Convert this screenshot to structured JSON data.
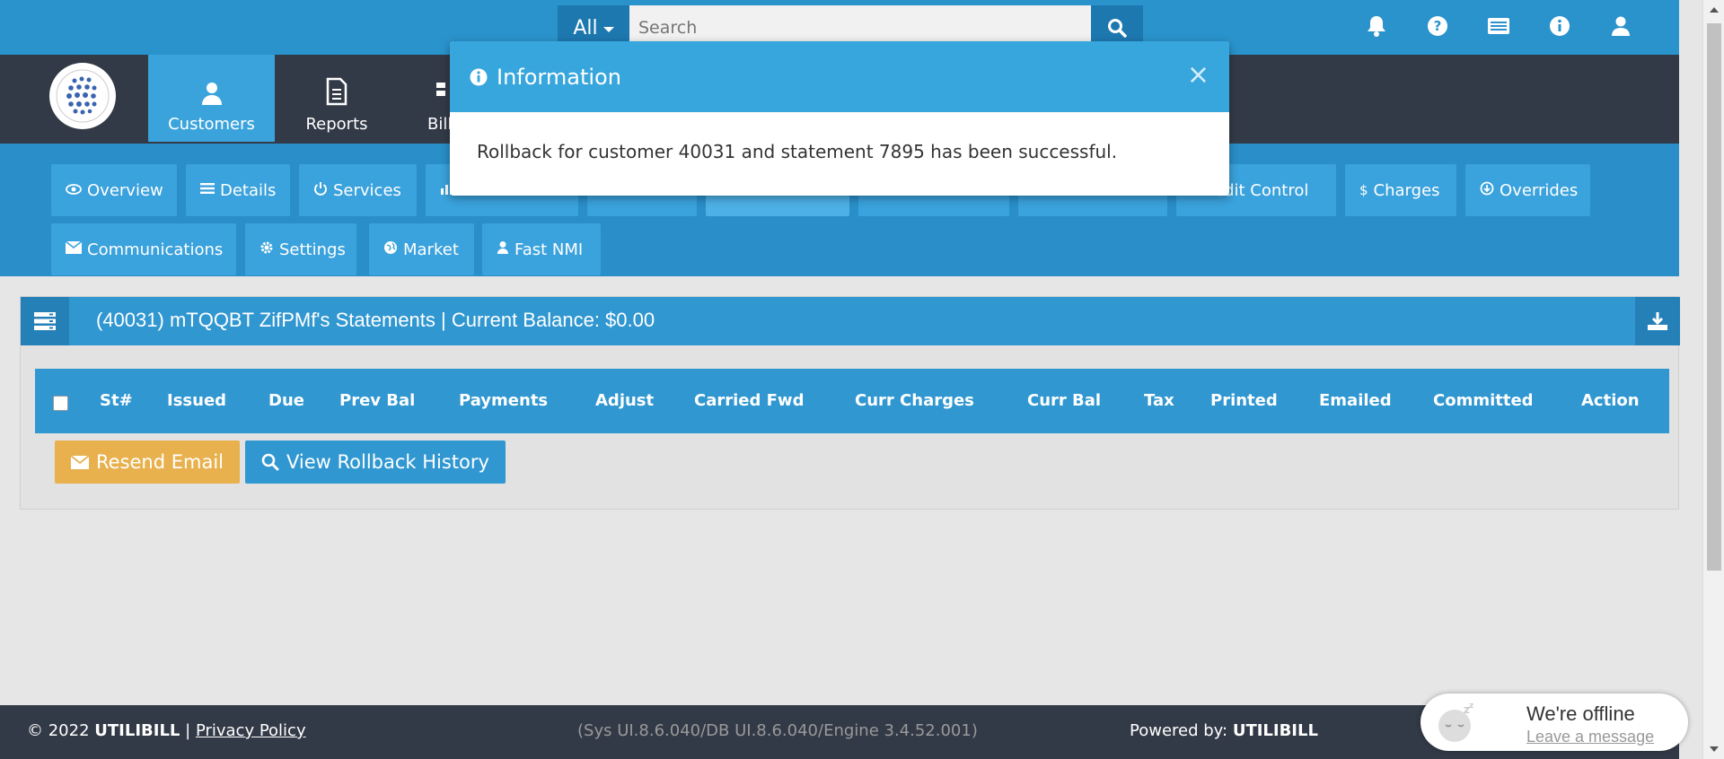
{
  "search": {
    "scope": "All",
    "placeholder": "Search"
  },
  "nav": {
    "items": [
      {
        "label": "Customers"
      },
      {
        "label": "Reports"
      },
      {
        "label": "Bill"
      }
    ]
  },
  "tabs": {
    "row1": [
      {
        "label": "Overview",
        "icon": "eye-icon"
      },
      {
        "label": "Details",
        "icon": "list-icon"
      },
      {
        "label": "Services",
        "icon": "power-icon"
      },
      {
        "label": "",
        "icon": "chart-icon"
      },
      {
        "label": "",
        "icon": ""
      },
      {
        "label": "",
        "icon": ""
      },
      {
        "label": "",
        "icon": ""
      },
      {
        "label": "",
        "icon": ""
      },
      {
        "label": "edit Control",
        "icon": ""
      },
      {
        "label": "Charges",
        "icon": "dollar-icon"
      },
      {
        "label": "Overrides",
        "icon": "arrow-circle-icon"
      }
    ],
    "row2": [
      {
        "label": "Communications",
        "icon": "envelope-icon"
      },
      {
        "label": "Settings",
        "icon": "cog-icon"
      },
      {
        "label": "Market",
        "icon": "globe-icon"
      },
      {
        "label": "Fast NMI",
        "icon": "user-icon"
      }
    ]
  },
  "panel": {
    "title": "(40031) mTQQBT ZifPMf's Statements | Current Balance: $0.00",
    "columns": [
      "St#",
      "Issued",
      "Due",
      "Prev Bal",
      "Payments",
      "Adjust",
      "Carried Fwd",
      "Curr Charges",
      "Curr Bal",
      "Tax",
      "Printed",
      "Emailed",
      "Committed",
      "Action"
    ],
    "buttons": {
      "resend": "Resend Email",
      "rollback": "View Rollback History"
    }
  },
  "modal": {
    "title": "Information",
    "message": "Rollback for customer 40031 and statement 7895 has been successful.",
    "close": "×"
  },
  "footer": {
    "copyright": "© 2022",
    "brand": "UTILIBILL",
    "separator": "|",
    "privacy": "Privacy Policy",
    "version": "(Sys UI.8.6.040/DB UI.8.6.040/Engine 3.4.52.001)",
    "powered_label": "Powered by:",
    "powered_brand": "UTILIBILL"
  },
  "chat": {
    "title": "We're offline",
    "link": "Leave a message"
  },
  "colors": {
    "topbar": "#2a93cc",
    "navbar": "#333a47",
    "tab": "#3aa2dc",
    "warning": "#e8b14e",
    "primary": "#3097d1"
  }
}
